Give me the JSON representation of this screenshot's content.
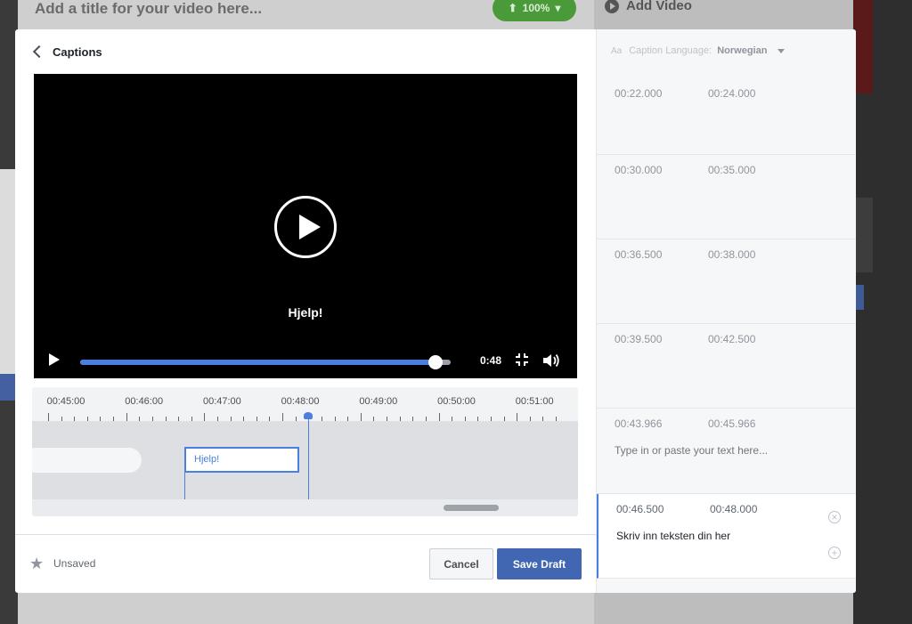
{
  "background": {
    "video_title_placeholder": "Add a title for your video here...",
    "upload_progress": "100%",
    "add_video_label": "Add Video"
  },
  "modal": {
    "title": "Captions",
    "player": {
      "caption": "Hjelp!",
      "time": "0:48",
      "progress_percent": 96
    },
    "timeline": {
      "ticks": [
        "00:45:00",
        "00:46:00",
        "00:47:00",
        "00:48:00",
        "00:49:00",
        "00:50:00",
        "00:51:00"
      ],
      "current_segment_text": "Hjelp!"
    },
    "footer": {
      "status": "Unsaved",
      "cancel_label": "Cancel",
      "save_label": "Save Draft"
    }
  },
  "side_panel": {
    "language_label": "Caption Language:",
    "language_value": "Norwegian",
    "cues": [
      {
        "start": "00:22.000",
        "end": "00:24.000",
        "text": ""
      },
      {
        "start": "00:30.000",
        "end": "00:35.000",
        "text": ""
      },
      {
        "start": "00:36.500",
        "end": "00:38.000",
        "text": ""
      },
      {
        "start": "00:39.500",
        "end": "00:42.500",
        "text": ""
      },
      {
        "start": "00:43.966",
        "end": "00:45.966",
        "placeholder": "Type in or paste your text here..."
      },
      {
        "start": "00:46.500",
        "end": "00:48.000",
        "text": "Skriv inn teksten din her"
      }
    ]
  }
}
